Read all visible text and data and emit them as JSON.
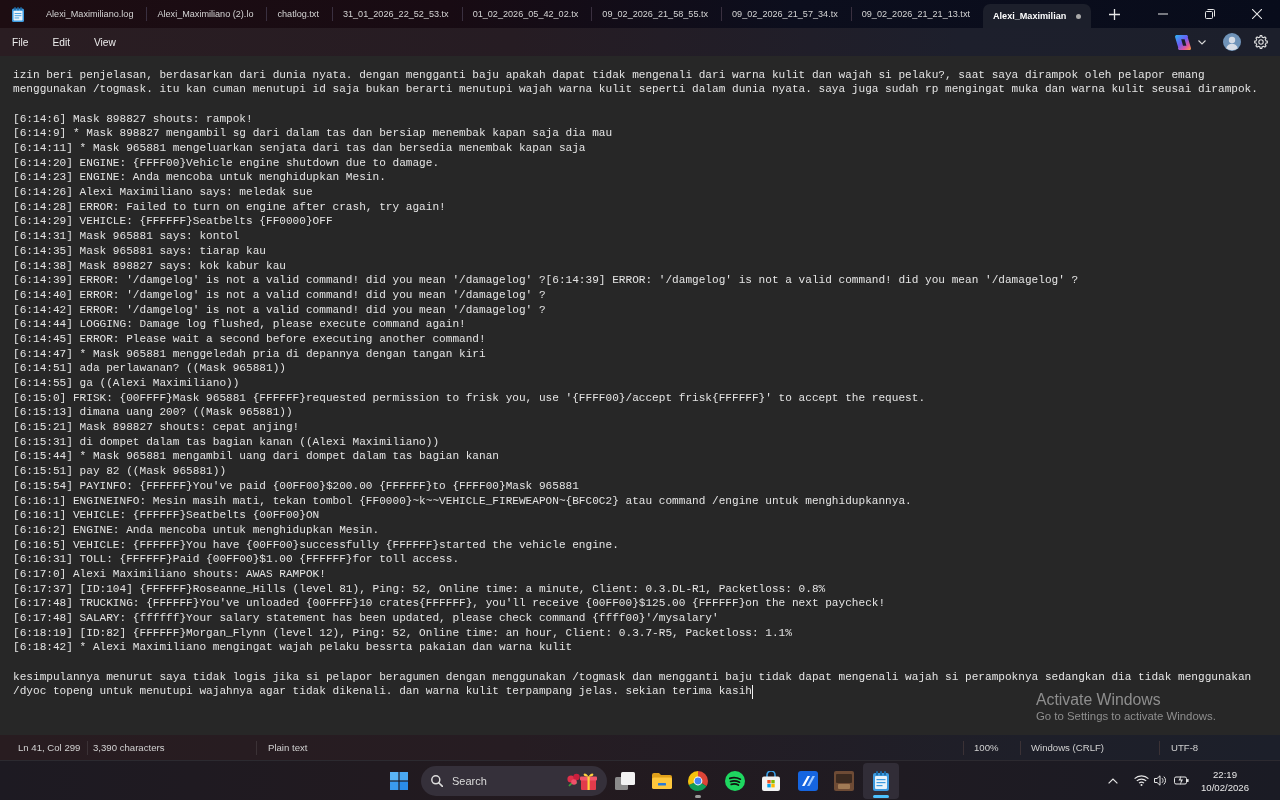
{
  "window": {
    "tabs": [
      {
        "label": "Alexi_Maximiliano.log",
        "selected": false,
        "modified": false
      },
      {
        "label": "Alexi_Maximiliano (2).lo",
        "selected": false,
        "modified": false
      },
      {
        "label": "chatlog.txt",
        "selected": false,
        "modified": false
      },
      {
        "label": "31_01_2026_22_52_53.tx",
        "selected": false,
        "modified": false
      },
      {
        "label": "01_02_2026_05_42_02.tx",
        "selected": false,
        "modified": false
      },
      {
        "label": "09_02_2026_21_58_55.tx",
        "selected": false,
        "modified": false
      },
      {
        "label": "09_02_2026_21_57_34.tx",
        "selected": false,
        "modified": false
      },
      {
        "label": "09_02_2026_21_21_13.txt",
        "selected": false,
        "modified": false
      },
      {
        "label": "Alexi_Maximilian",
        "selected": true,
        "modified": true
      }
    ]
  },
  "menu": [
    "File",
    "Edit",
    "View"
  ],
  "editor": {
    "caret": true,
    "blocks": [
      {
        "lines": [
          "izin beri penjelasan, berdasarkan dari dunia nyata. dengan mengganti baju apakah dapat tidak mengenali dari warna kulit dan wajah si pelaku?, saat saya dirampok oleh pelapor emang",
          "menggunakan /togmask. itu kan cuman menutupi id saja bukan berarti menutupi wajah warna kulit seperti dalam dunia nyata. saya juga sudah rp mengingat muka dan warna kulit seusai dirampok."
        ]
      },
      {
        "lines": [
          "[6:14:6] Mask 898827 shouts: rampok!",
          "[6:14:9] * Mask 898827 mengambil sg dari dalam tas dan bersiap menembak kapan saja dia mau",
          "[6:14:11] * Mask 965881 mengeluarkan senjata dari tas dan bersedia menembak kapan saja",
          "[6:14:20] ENGINE: {FFFF00}Vehicle engine shutdown due to damage.",
          "[6:14:23] ENGINE: Anda mencoba untuk menghidupkan Mesin.",
          "[6:14:26] Alexi Maximiliano says: meledak sue",
          "[6:14:28] ERROR: Failed to turn on engine after crash, try again!",
          "[6:14:29] VEHICLE: {FFFFFF}Seatbelts {FF0000}OFF",
          "[6:14:31] Mask 965881 says: kontol",
          "[6:14:35] Mask 965881 says: tiarap kau",
          "[6:14:38] Mask 898827 says: kok kabur kau",
          "[6:14:39] ERROR: '/damgelog' is not a valid command! did you mean '/damagelog' ?[6:14:39] ERROR: '/damgelog' is not a valid command! did you mean '/damagelog' ?",
          "[6:14:40] ERROR: '/damgelog' is not a valid command! did you mean '/damagelog' ?",
          "[6:14:42] ERROR: '/damgelog' is not a valid command! did you mean '/damagelog' ?",
          "[6:14:44] LOGGING: Damage log flushed, please execute command again!",
          "[6:14:45] ERROR: Please wait a second before executing another command!",
          "[6:14:47] * Mask 965881 menggeledah pria di depannya dengan tangan kiri",
          "[6:14:51] ada perlawanan? ((Mask 965881))",
          "[6:14:55] ga ((Alexi Maximiliano))",
          "[6:15:0] FRISK: {00FFFF}Mask 965881 {FFFFFF}requested permission to frisk you, use '{FFFF00}/accept frisk{FFFFFF}' to accept the request.",
          "[6:15:13] dimana uang 200? ((Mask 965881))",
          "[6:15:21] Mask 898827 shouts: cepat anjing!",
          "[6:15:31] di dompet dalam tas bagian kanan ((Alexi Maximiliano))",
          "[6:15:44] * Mask 965881 mengambil uang dari dompet dalam tas bagian kanan",
          "[6:15:51] pay 82 ((Mask 965881))",
          "[6:15:54] PAYINFO: {FFFFFF}You've paid {00FF00}$200.00 {FFFFFF}to {FFFF00}Mask 965881",
          "[6:16:1] ENGINEINFO: Mesin masih mati, tekan tombol {FF0000}~k~~VEHICLE_FIREWEAPON~{BFC0C2} atau command /engine untuk menghidupkannya.",
          "[6:16:1] VEHICLE: {FFFFFF}Seatbelts {00FF00}ON",
          "[6:16:2] ENGINE: Anda mencoba untuk menghidupkan Mesin.",
          "[6:16:5] VEHICLE: {FFFFFF}You have {00FF00}successfully {FFFFFF}started the vehicle engine.",
          "[6:16:31] TOLL: {FFFFFF}Paid {00FF00}$1.00 {FFFFFF}for toll access.",
          "[6:17:0] Alexi Maximiliano shouts: AWAS RAMPOK!",
          "[6:17:37] [ID:104] {FFFFFF}Roseanne_Hills (level 81), Ping: 52, Online time: a minute, Client: 0.3.DL-R1, Packetloss: 0.8%",
          "[6:17:48] TRUCKING: {FFFFFF}You've unloaded {00FFFF}10 crates{FFFFFF}, you'll receive {00FF00}$125.00 {FFFFFF}on the next paycheck!",
          "[6:17:48] SALARY: {ffffff}Your salary statement has been updated, please check command {ffff00}'/mysalary'",
          "[6:18:19] [ID:82] {FFFFFF}Morgan_Flynn (level 12), Ping: 52, Online time: an hour, Client: 0.3.7-R5, Packetloss: 1.1%",
          "[6:18:42] * Alexi Maximiliano mengingat wajah pelaku bessrta pakaian dan warna kulit"
        ]
      },
      {
        "lines": [
          "kesimpulannya menurut saya tidak logis jika si pelapor beragumen dengan menggunakan /togmask dan mengganti baju tidak dapat mengenali wajah si perampoknya sedangkan dia tidak menggunakan",
          "/dyoc topeng untuk menutupi wajahnya agar tidak dikenali. dan warna kulit terpampang jelas. sekian terima kasih"
        ]
      }
    ]
  },
  "activation_notice": {
    "title": "Activate Windows",
    "text": "Go to Settings to activate Windows."
  },
  "status_bar": {
    "position": "Ln 41, Col 299",
    "characters": "3,390 characters",
    "file_type": "Plain text",
    "zoom": "100%",
    "line_ending": "Windows (CRLF)",
    "encoding": "UTF-8"
  },
  "taskbar": {
    "search": {
      "placeholder": "Search"
    },
    "apps": [
      {
        "kind": "task_view",
        "running": false,
        "selected": false
      },
      {
        "kind": "folder",
        "running": false,
        "selected": false
      },
      {
        "kind": "browser",
        "running": true,
        "selected": false
      },
      {
        "kind": "music",
        "running": false,
        "selected": false
      },
      {
        "kind": "store",
        "running": false,
        "selected": false
      },
      {
        "kind": "stripes",
        "running": false,
        "selected": false
      },
      {
        "kind": "picture",
        "running": false,
        "selected": false
      },
      {
        "kind": "notepad",
        "running": true,
        "selected": true
      }
    ],
    "clock": {
      "time": "22:19",
      "date": "10/02/2026"
    }
  }
}
